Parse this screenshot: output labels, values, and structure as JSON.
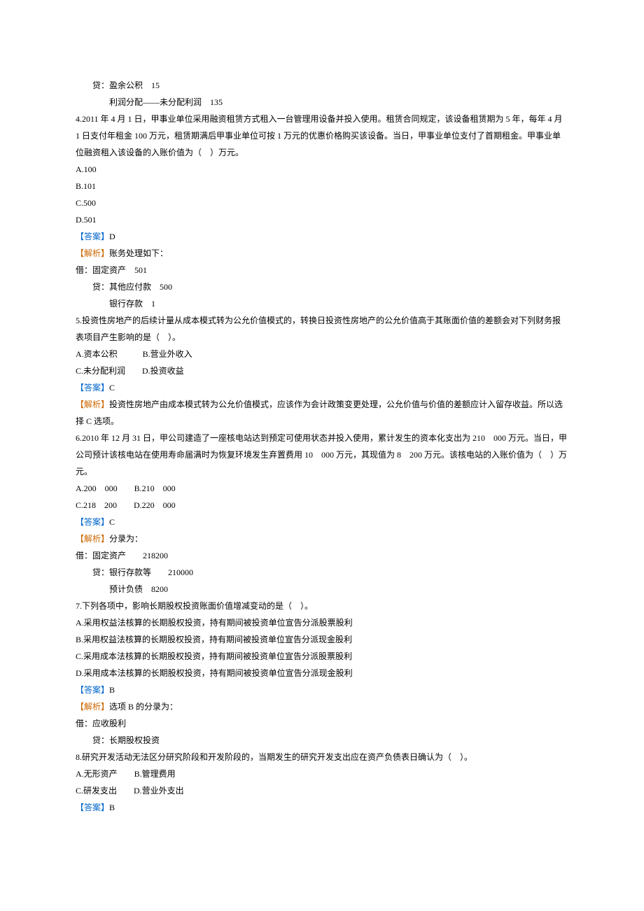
{
  "lines": [
    {
      "cls": "line indent-1",
      "segs": [
        {
          "t": "贷：盈余公积　15"
        }
      ]
    },
    {
      "cls": "line indent-2",
      "segs": [
        {
          "t": "利润分配——未分配利润　135"
        }
      ]
    },
    {
      "cls": "line",
      "segs": [
        {
          "t": "4.2011 年 4 月 1 日，甲事业单位采用融资租赁方式租入一台管理用设备并投入使用。租赁合同规定，该设备租赁期为 5 年，每年 4 月 1 日支付年租金 100 万元，租赁期满后甲事业单位可按 1 万元的优惠价格购买该设备。当日，甲事业单位支付了首期租金。甲事业单位融资租入该设备的入账价值为（　）万元。"
        }
      ]
    },
    {
      "cls": "line",
      "segs": [
        {
          "t": "A.100"
        }
      ]
    },
    {
      "cls": "line",
      "segs": [
        {
          "t": "B.101"
        }
      ]
    },
    {
      "cls": "line",
      "segs": [
        {
          "t": "C.500"
        }
      ]
    },
    {
      "cls": "line",
      "segs": [
        {
          "t": "D.501"
        }
      ]
    },
    {
      "cls": "line",
      "segs": [
        {
          "t": "【答案】",
          "c": "label-answer"
        },
        {
          "t": "D"
        }
      ]
    },
    {
      "cls": "line",
      "segs": [
        {
          "t": "【解析】",
          "c": "label-explain"
        },
        {
          "t": "账务处理如下："
        }
      ]
    },
    {
      "cls": "line",
      "segs": [
        {
          "t": "借：固定资产　501"
        }
      ]
    },
    {
      "cls": "line indent-1",
      "segs": [
        {
          "t": "贷：其他应付款　500"
        }
      ]
    },
    {
      "cls": "line indent-2",
      "segs": [
        {
          "t": "银行存款　1"
        }
      ]
    },
    {
      "cls": "line",
      "segs": [
        {
          "t": "5.投资性房地产的后续计量从成本模式转为公允价值模式的，转换日投资性房地产的公允价值高于其账面价值的差额会对下列财务报表项目产生影响的是（　）。"
        }
      ]
    },
    {
      "cls": "line",
      "segs": [
        {
          "t": "A.资本公积　　　B.营业外收入"
        }
      ]
    },
    {
      "cls": "line",
      "segs": [
        {
          "t": "C.未分配利润　　D.投资收益"
        }
      ]
    },
    {
      "cls": "line",
      "segs": [
        {
          "t": "【答案】",
          "c": "label-answer"
        },
        {
          "t": "C"
        }
      ]
    },
    {
      "cls": "line",
      "segs": [
        {
          "t": "【解析】",
          "c": "label-explain"
        },
        {
          "t": "投资性房地产由成本模式转为公允价值模式，应该作为会计政策变更处理，公允价值与价值的差额应计入留存收益。所以选择 C 选项。"
        }
      ]
    },
    {
      "cls": "line",
      "segs": [
        {
          "t": "6.2010 年 12 月 31 日，甲公司建造了一座核电站达到预定可使用状态并投入使用，累计发生的资本化支出为 210　000 万元。当日，甲公司预计该核电站在使用寿命届满时为恢复环境发生弃置费用 10　000 万元，其现值为 8　200 万元。该核电站的入账价值为（　）万元。"
        }
      ]
    },
    {
      "cls": "line",
      "segs": [
        {
          "t": "A.200　000　　B.210　000"
        }
      ]
    },
    {
      "cls": "line",
      "segs": [
        {
          "t": "C.218　200　　D.220　000"
        }
      ]
    },
    {
      "cls": "line",
      "segs": [
        {
          "t": "【答案】",
          "c": "label-answer"
        },
        {
          "t": "C"
        }
      ]
    },
    {
      "cls": "line",
      "segs": [
        {
          "t": "【解析】",
          "c": "label-explain"
        },
        {
          "t": "分录为："
        }
      ]
    },
    {
      "cls": "line",
      "segs": [
        {
          "t": "借：固定资产　　218200"
        }
      ]
    },
    {
      "cls": "line indent-1",
      "segs": [
        {
          "t": "贷：银行存款等　　210000"
        }
      ]
    },
    {
      "cls": "line indent-2",
      "segs": [
        {
          "t": "预计负债　8200"
        }
      ]
    },
    {
      "cls": "line",
      "segs": [
        {
          "t": "7.下列各项中，影响长期股权投资账面价值增减变动的是（　）。"
        }
      ]
    },
    {
      "cls": "line",
      "segs": [
        {
          "t": "A.采用权益法核算的长期股权投资，持有期间被投资单位宣告分派股票股利"
        }
      ]
    },
    {
      "cls": "line",
      "segs": [
        {
          "t": "B.采用权益法核算的长期股权投资，持有期间被投资单位宣告分派现金股利"
        }
      ]
    },
    {
      "cls": "line",
      "segs": [
        {
          "t": "C.采用成本法核算的长期股权投资，持有期间被投资单位宣告分派股票股利"
        }
      ]
    },
    {
      "cls": "line",
      "segs": [
        {
          "t": "D.采用成本法核算的长期股权投资，持有期间被投资单位宣告分派现金股利"
        }
      ]
    },
    {
      "cls": "line",
      "segs": [
        {
          "t": "【答案】",
          "c": "label-answer"
        },
        {
          "t": "B"
        }
      ]
    },
    {
      "cls": "line",
      "segs": [
        {
          "t": "【解析】",
          "c": "label-explain"
        },
        {
          "t": "选项 B 的分录为："
        }
      ]
    },
    {
      "cls": "line",
      "segs": [
        {
          "t": "借：应收股利"
        }
      ]
    },
    {
      "cls": "line indent-1",
      "segs": [
        {
          "t": "贷：长期股权投资"
        }
      ]
    },
    {
      "cls": "line",
      "segs": [
        {
          "t": "8.研究开发活动无法区分研究阶段和开发阶段的，当期发生的研究开发支出应在资产负债表日确认为（　）。"
        }
      ]
    },
    {
      "cls": "line",
      "segs": [
        {
          "t": "A.无形资产　　B.管理费用"
        }
      ]
    },
    {
      "cls": "line",
      "segs": [
        {
          "t": "C.研发支出　　D.营业外支出"
        }
      ]
    },
    {
      "cls": "line",
      "segs": [
        {
          "t": "【答案】",
          "c": "label-answer"
        },
        {
          "t": "B"
        }
      ]
    }
  ]
}
